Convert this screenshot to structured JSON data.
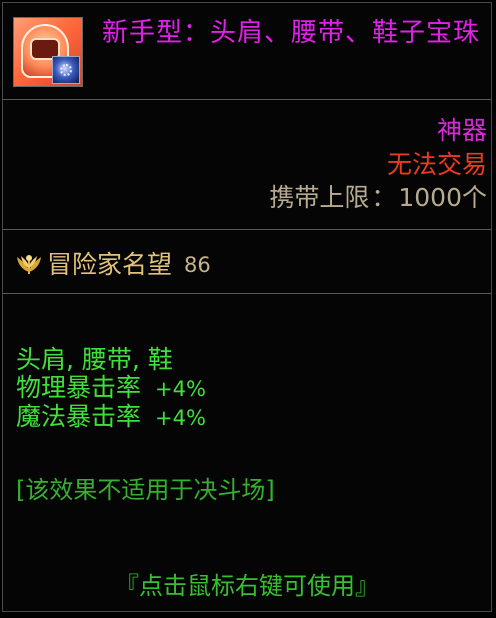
{
  "item": {
    "title": "新手型：头肩、腰带、鞋子宝珠",
    "icon": "helmet-with-gem-orb-icon",
    "rarity": "神器",
    "trade_status": "无法交易",
    "carry_limit_label": "携带上限",
    "carry_limit_separator": "：",
    "carry_limit_value": "1000个"
  },
  "fame": {
    "icon": "adventurer-fame-wings-icon",
    "label": "冒险家名望",
    "value": "86"
  },
  "effects": {
    "slots": "头肩, 腰带, 鞋",
    "stats": [
      {
        "name": "物理暴击率",
        "value": "+4%"
      },
      {
        "name": "魔法暴击率",
        "value": "+4%"
      }
    ],
    "note": "[该效果不适用于决斗场]"
  },
  "usage_hint": "『点击鼠标右键可使用』",
  "colors": {
    "title": "#e021e8",
    "rarity": "#d62ad8",
    "trade": "#ea3a22",
    "limit": "#b7aa8f",
    "fame": "#e0c27a",
    "effect": "#3fe03a"
  }
}
